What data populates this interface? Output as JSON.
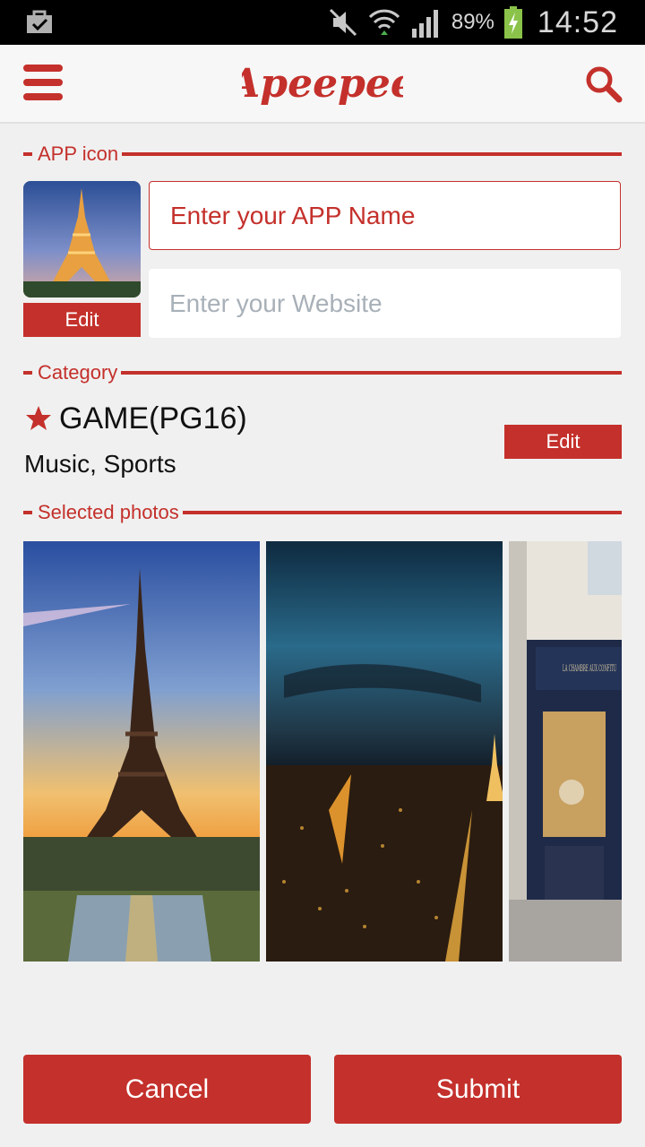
{
  "status_bar": {
    "battery_percent": "89%",
    "time": "14:52",
    "icons": [
      "bag-check-icon",
      "mute-icon",
      "wifi-icon",
      "signal-icon",
      "battery-charging-icon"
    ]
  },
  "app_bar": {
    "logo_text": "Apeepee",
    "menu_icon": "hamburger-menu-icon",
    "search_icon": "search-icon"
  },
  "app_icon_section": {
    "header": "APP icon",
    "edit_label": "Edit",
    "name_placeholder": "Enter your APP Name",
    "website_placeholder": "Enter your Website"
  },
  "category_section": {
    "header": "Category",
    "title": "GAME(PG16)",
    "subcategories": "Music, Sports",
    "edit_label": "Edit"
  },
  "photos_section": {
    "header": "Selected photos",
    "photos": [
      {
        "subject": "eiffel-tower-sunset"
      },
      {
        "subject": "paris-night-city"
      },
      {
        "subject": "paris-shop-storefront",
        "sign_text": "LA CHAMBRE AUX CONFITU"
      }
    ]
  },
  "actions": {
    "cancel_label": "Cancel",
    "submit_label": "Submit"
  },
  "colors": {
    "accent": "#c4302b",
    "background": "#f0f0f0"
  }
}
